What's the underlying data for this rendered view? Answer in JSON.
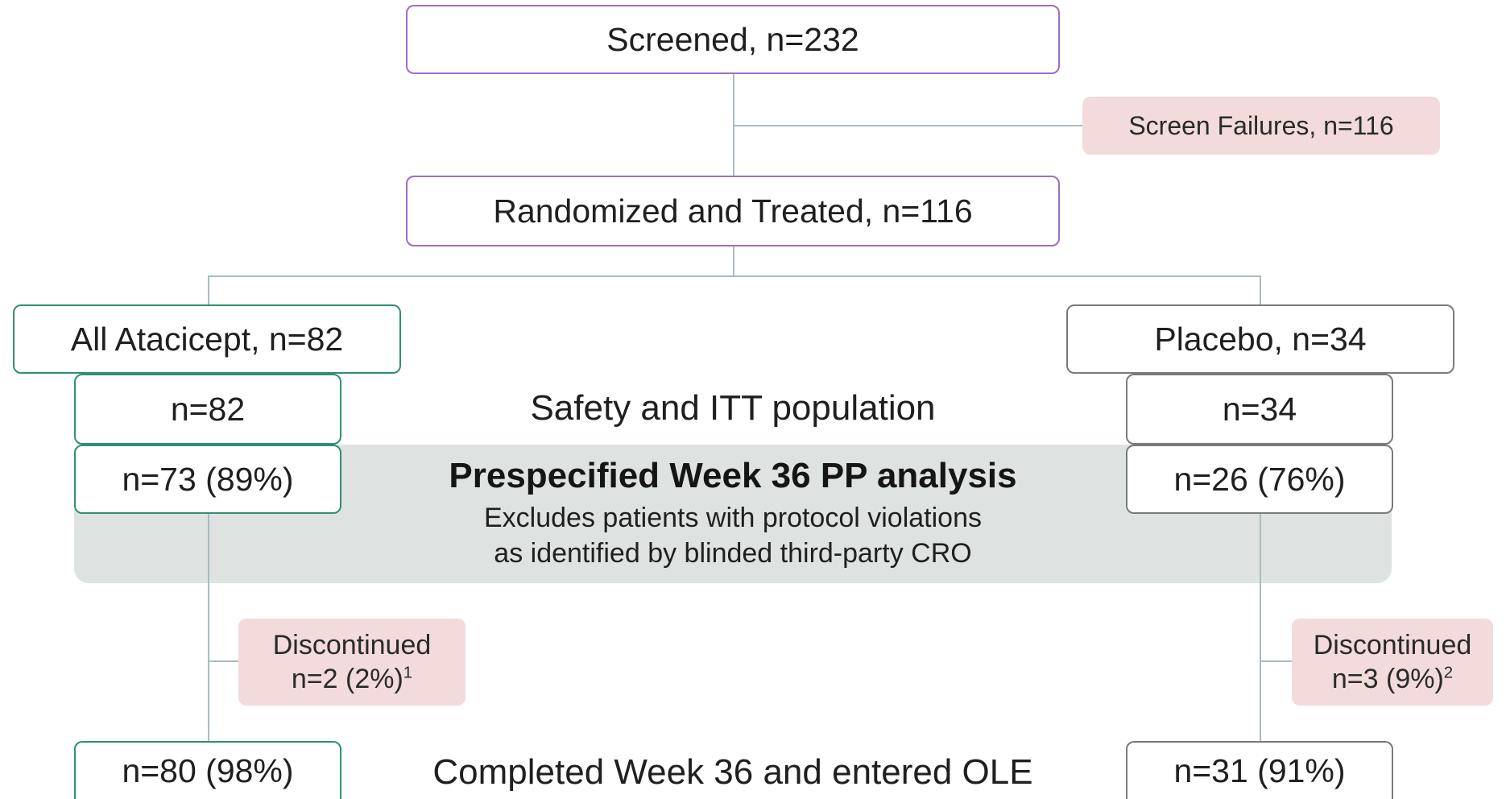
{
  "screened": "Screened, n=232",
  "screen_failures": "Screen Failures, n=116",
  "randomized": "Randomized and Treated, n=116",
  "arms": {
    "atacicept": {
      "header": "All Atacicept, n=82",
      "safety_n": "n=82",
      "pp_n": "n=73 (89%)",
      "discontinued_label": "Discontinued",
      "discontinued_n": "n=2 (2%)",
      "discontinued_footnote": "1",
      "completed_n": "n=80 (98%)"
    },
    "placebo": {
      "header": "Placebo, n=34",
      "safety_n": "n=34",
      "pp_n": "n=26 (76%)",
      "discontinued_label": "Discontinued",
      "discontinued_n": "n=3 (9%)",
      "discontinued_footnote": "2",
      "completed_n": "n=31 (91%)"
    }
  },
  "safety_label": "Safety and ITT population",
  "pp_analysis": {
    "title": "Prespecified Week 36 PP analysis",
    "line1": "Excludes patients with protocol violations",
    "line2": "as identified by blinded third-party CRO"
  },
  "completed_label": "Completed Week 36 and entered OLE"
}
